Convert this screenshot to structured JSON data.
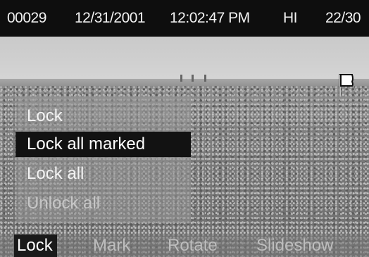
{
  "status": {
    "file_number": "00029",
    "date": "12/31/2001",
    "time": "12:02:47 PM",
    "quality": "HI",
    "frame_count": "22/30"
  },
  "menu": {
    "items": [
      {
        "label": "Lock",
        "state": "normal"
      },
      {
        "label": "Lock all marked",
        "state": "selected"
      },
      {
        "label": "Lock all",
        "state": "normal"
      },
      {
        "label": "Unlock all",
        "state": "disabled"
      }
    ]
  },
  "function_bar": {
    "items": [
      {
        "label": "Lock",
        "active": true
      },
      {
        "label": "Mark",
        "active": false
      },
      {
        "label": "Rotate",
        "active": false
      },
      {
        "label": "Slideshow",
        "active": false
      }
    ]
  },
  "icons": {
    "flag": "flag-icon"
  }
}
